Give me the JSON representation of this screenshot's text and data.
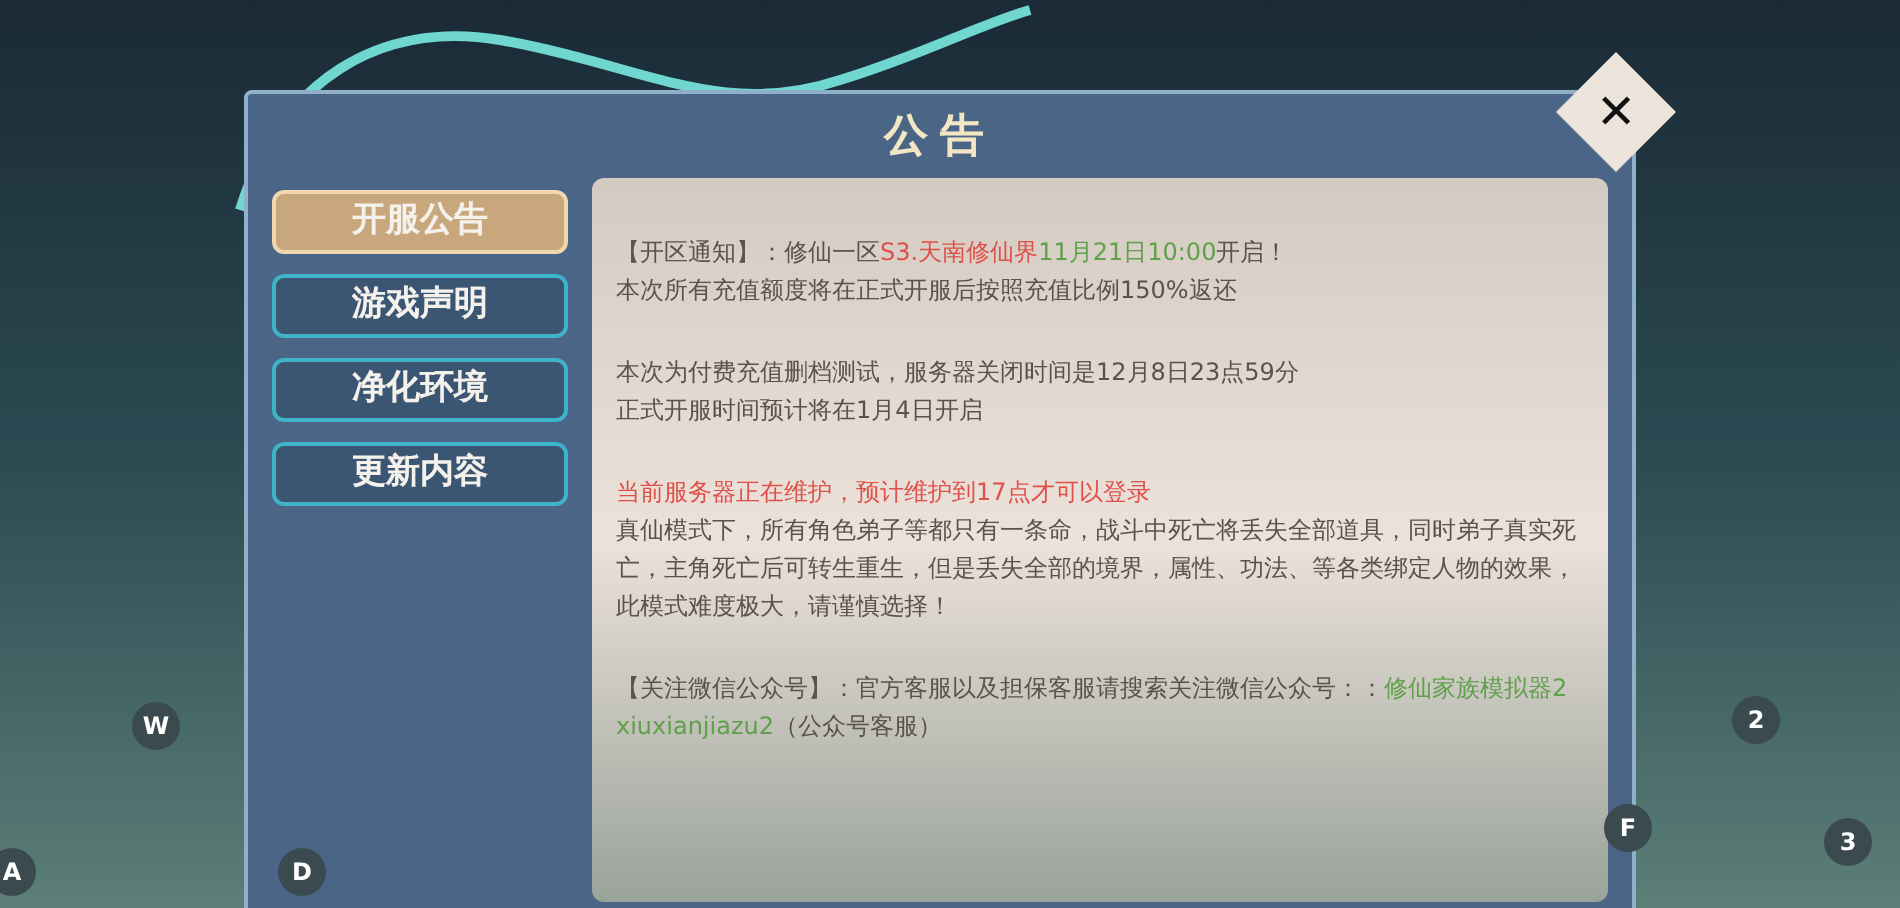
{
  "dialog": {
    "title": "公告",
    "close": "✕"
  },
  "tabs": [
    {
      "label": "开服公告",
      "selected": true
    },
    {
      "label": "游戏声明",
      "selected": false
    },
    {
      "label": "净化环境",
      "selected": false
    },
    {
      "label": "更新内容",
      "selected": false
    }
  ],
  "content": {
    "blocks": [
      {
        "lines": [
          [
            {
              "text": "【开区通知】：修仙一区",
              "color": "#5a524c"
            },
            {
              "text": "S3.天南修仙界",
              "color": "#e0504a"
            },
            {
              "text": "11月21日10:00",
              "color": "#5fa04a"
            },
            {
              "text": "开启！",
              "color": "#5a524c"
            }
          ],
          [
            {
              "text": "本次所有充值额度将在正式开服后按照充值比例150%返还",
              "color": "#5a524c"
            }
          ]
        ]
      },
      {
        "lines": [
          [
            {
              "text": "本次为付费充值删档测试，服务器关闭时间是12月8日23点59分",
              "color": "#5a524c"
            }
          ],
          [
            {
              "text": "正式开服时间预计将在1月4日开启",
              "color": "#5a524c"
            }
          ]
        ]
      },
      {
        "lines": [
          [
            {
              "text": "当前服务器正在维护，预计维护到17点才可以登录",
              "color": "#e0504a"
            }
          ],
          [
            {
              "text": "真仙模式下，所有角色弟子等都只有一条命，战斗中死亡将丢失全部道具，同时弟子真实死亡，主角死亡后可转生重生，但是丢失全部的境界，属性、功法、等各类绑定人物的效果，此模式难度极大，请谨慎选择！",
              "color": "#5a524c"
            }
          ]
        ]
      },
      {
        "lines": [
          [
            {
              "text": "【关注微信公众号】：官方客服以及担保客服请搜索关注微信公众号：：",
              "color": "#5a524c"
            },
            {
              "text": "修仙家族模拟器2 xiuxianjiazu2",
              "color": "#5fa04a"
            },
            {
              "text": "（公众号客服）",
              "color": "#5a524c"
            }
          ]
        ]
      }
    ]
  },
  "key_hints": [
    {
      "label": "W"
    },
    {
      "label": "A"
    },
    {
      "label": "D"
    },
    {
      "label": "2"
    },
    {
      "label": "F"
    },
    {
      "label": "3"
    }
  ]
}
